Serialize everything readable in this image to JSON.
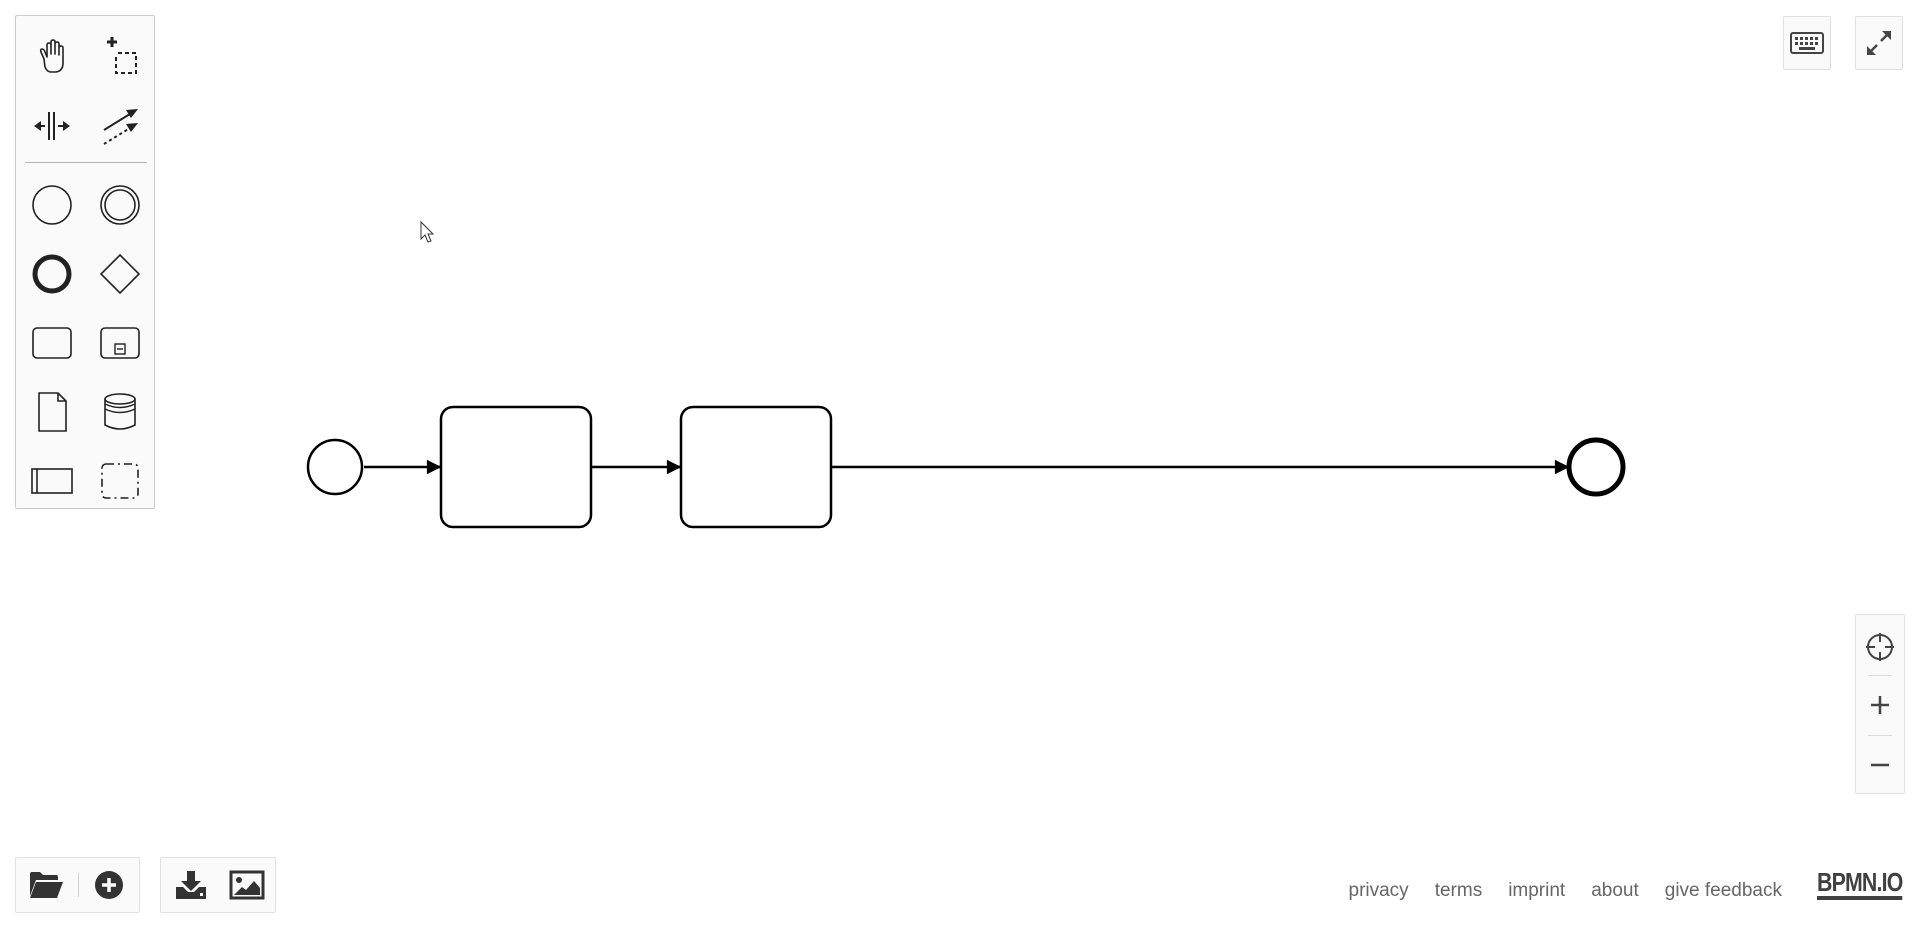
{
  "app": {
    "brand": "BPMN.IO"
  },
  "palette": {
    "tools": [
      "hand-tool",
      "lasso-tool",
      "space-tool",
      "global-connect-tool",
      "start-event",
      "intermediate-event",
      "end-event",
      "gateway",
      "task",
      "subprocess",
      "data-object",
      "data-store",
      "pool",
      "group"
    ]
  },
  "top_buttons": [
    "keyboard-icon",
    "fullscreen-icon"
  ],
  "zoom": [
    "reset-zoom-icon",
    "zoom-in-icon",
    "zoom-out-icon"
  ],
  "bottom_buttons": {
    "file": [
      "open-folder-icon",
      "new-diagram-icon"
    ],
    "export": [
      "download-icon",
      "export-image-icon"
    ]
  },
  "footer": {
    "privacy": "privacy",
    "terms": "terms",
    "imprint": "imprint",
    "about": "about",
    "feedback": "give feedback"
  },
  "colors": {
    "stroke": "#000000",
    "palette_bg": "#fafafa",
    "link": "#666666"
  }
}
